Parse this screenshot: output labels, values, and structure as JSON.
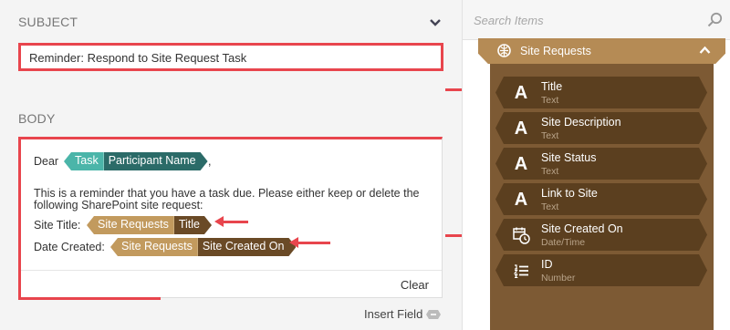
{
  "subject": {
    "label": "SUBJECT",
    "value": "Reminder: Respond to Site Request Task"
  },
  "body": {
    "label": "BODY",
    "dear": "Dear",
    "comma": ",",
    "paragraph": "This is a reminder that you have a task due. Please either keep or delete the following SharePoint site request:",
    "site_title_label": "Site Title:",
    "date_created_label": "Date Created:",
    "tokens": {
      "participant": {
        "source": "Task",
        "field": "Participant Name"
      },
      "title": {
        "source": "Site Requests",
        "field": "Title"
      },
      "created": {
        "source": "Site Requests",
        "field": "Site Created On"
      }
    },
    "clear_label": "Clear"
  },
  "insert_field_label": "Insert Field",
  "search": {
    "placeholder": "Search Items"
  },
  "group": {
    "title": "Site Requests",
    "items": [
      {
        "name": "Title",
        "type": "Text",
        "icon": "text-icon"
      },
      {
        "name": "Site Description",
        "type": "Text",
        "icon": "text-icon"
      },
      {
        "name": "Site Status",
        "type": "Text",
        "icon": "text-icon"
      },
      {
        "name": "Link to Site",
        "type": "Text",
        "icon": "text-icon"
      },
      {
        "name": "Site Created On",
        "type": "Date/Time",
        "icon": "calendar-clock-icon"
      },
      {
        "name": "ID",
        "type": "Number",
        "icon": "numbered-list-icon"
      }
    ]
  },
  "colors": {
    "annotation_red": "#e8454d",
    "task_token": "#4bb5a9",
    "task_field": "#2b6b68",
    "site_token": "#c29a5e",
    "site_field": "#6a4a26",
    "group_header": "#b58b55",
    "group_body": "#7d5a34",
    "item_bg": "#5b3f1f"
  }
}
